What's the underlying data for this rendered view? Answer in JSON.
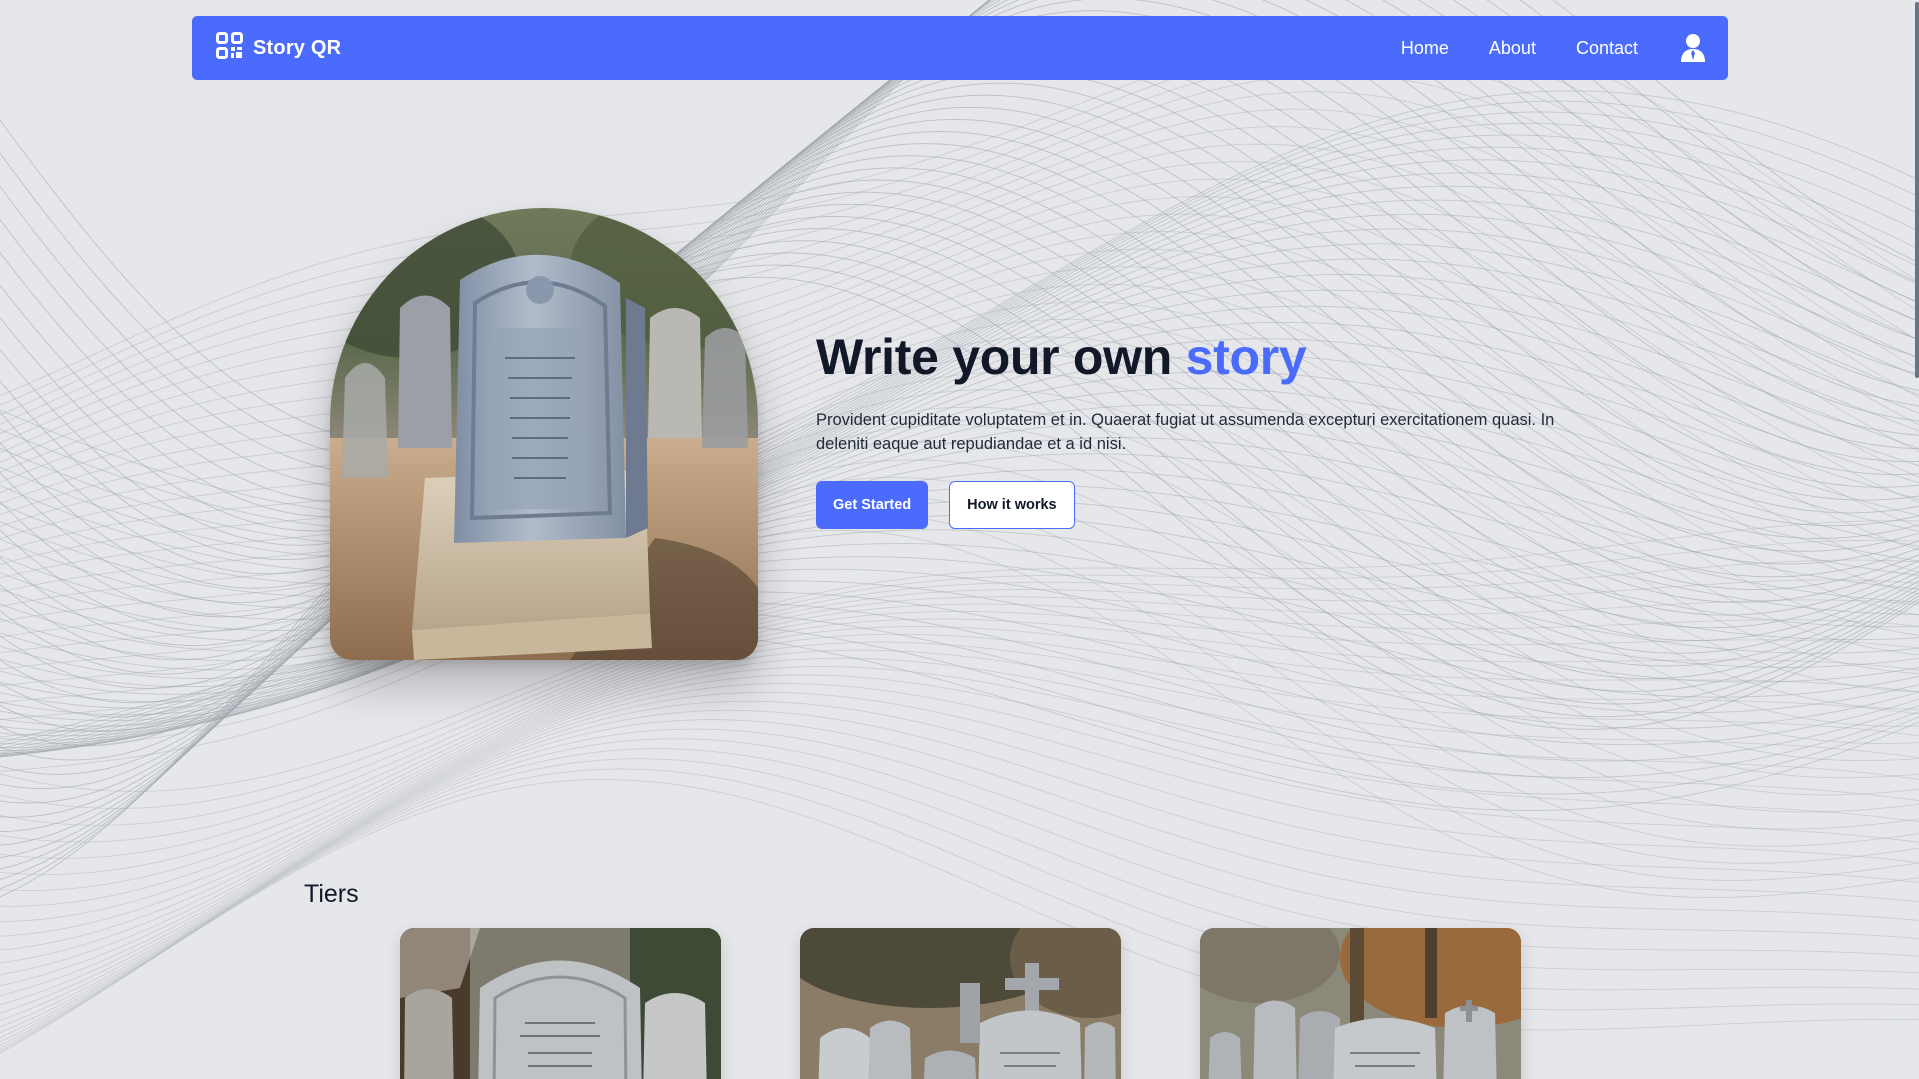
{
  "colors": {
    "accent": "#4a6bfb",
    "background": "#e6e7ea",
    "text": "#111827"
  },
  "navbar": {
    "brand": "Story QR",
    "brand_icon": "qr-code-icon",
    "links": [
      "Home",
      "About",
      "Contact"
    ],
    "user_icon": "user-icon"
  },
  "hero": {
    "title_main": "Write your own ",
    "title_accent": "story",
    "description": "Provident cupiditate voluptatem et in. Quaerat fugiat ut assumenda excepturi exercitationem quasi. In deleniti eaque aut repudiandae et a id nisi.",
    "primary_button": "Get Started",
    "secondary_button": "How it works"
  },
  "tiers": {
    "title": "Tiers"
  }
}
